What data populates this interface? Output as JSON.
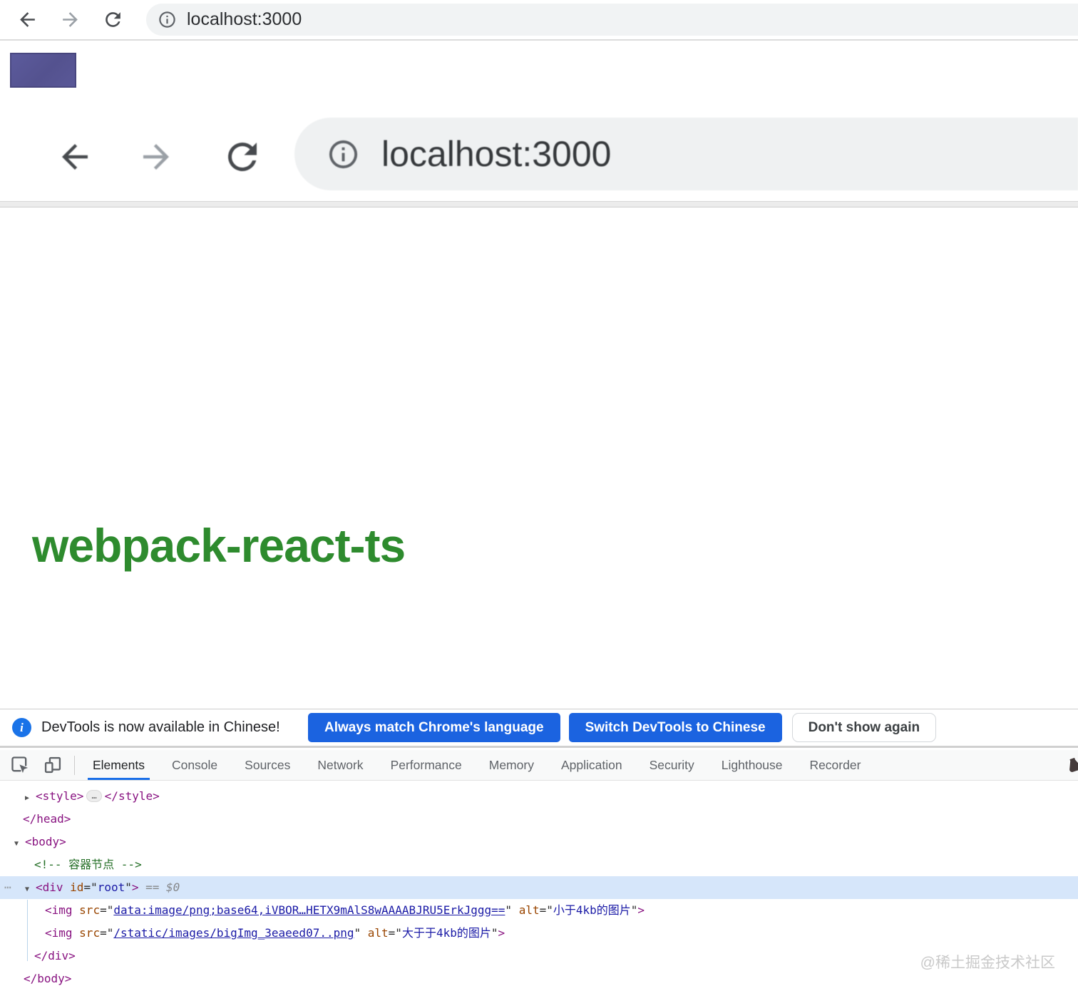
{
  "browser": {
    "url": "localhost:3000"
  },
  "page": {
    "heading": "webpack-react-ts",
    "screenshot_image": {
      "url": "localhost:3000"
    }
  },
  "infobar": {
    "badge_glyph": "i",
    "message": "DevTools is now available in Chinese!",
    "match_button": "Always match Chrome's language",
    "switch_button": "Switch DevTools to Chinese",
    "dismiss_button": "Don't show again"
  },
  "devtools": {
    "tabs": [
      {
        "label": "Elements",
        "active": true
      },
      {
        "label": "Console"
      },
      {
        "label": "Sources"
      },
      {
        "label": "Network"
      },
      {
        "label": "Performance"
      },
      {
        "label": "Memory"
      },
      {
        "label": "Application"
      },
      {
        "label": "Security"
      },
      {
        "label": "Lighthouse"
      },
      {
        "label": "Recorder"
      }
    ],
    "code_lines": [
      {
        "pad": 35,
        "tokens": [
          [
            "arrow",
            "▶"
          ],
          [
            "tag",
            "<style>"
          ],
          [
            "pill",
            "…"
          ],
          [
            "tag",
            "</style>"
          ]
        ]
      },
      {
        "pad": 32,
        "tokens": [
          [
            "tag",
            "</head>"
          ]
        ]
      },
      {
        "pad": 20,
        "tokens": [
          [
            "arrow",
            "▼"
          ],
          [
            "tag",
            "<body>"
          ]
        ]
      },
      {
        "pad": 48,
        "tokens": [
          [
            "comment",
            "<!-- 容器节点 -->"
          ]
        ]
      },
      {
        "pad": 35,
        "selected": true,
        "dots": "⋯",
        "tokens": [
          [
            "arrow",
            "▼"
          ],
          [
            "tag",
            "<div"
          ],
          [
            "plain",
            " "
          ],
          [
            "attr",
            "id"
          ],
          [
            "plain",
            "=\""
          ],
          [
            "val",
            "root"
          ],
          [
            "plain",
            "\""
          ],
          [
            "tag",
            ">"
          ],
          [
            "meta",
            " == "
          ],
          [
            "metai",
            "$0"
          ]
        ]
      },
      {
        "pad": 63,
        "tokens": [
          [
            "tag",
            "<img"
          ],
          [
            "plain",
            " "
          ],
          [
            "attr",
            "src"
          ],
          [
            "plain",
            "=\""
          ],
          [
            "link",
            "data:image/png;base64,iVBOR…HETX9mAlS8wAAAABJRU5ErkJggg=="
          ],
          [
            "plain",
            "\" "
          ],
          [
            "attr",
            "alt"
          ],
          [
            "plain",
            "=\""
          ],
          [
            "val",
            "小于4kb的图片"
          ],
          [
            "plain",
            "\""
          ],
          [
            "tag",
            ">"
          ]
        ]
      },
      {
        "pad": 63,
        "tokens": [
          [
            "tag",
            "<img"
          ],
          [
            "plain",
            " "
          ],
          [
            "attr",
            "src"
          ],
          [
            "plain",
            "=\""
          ],
          [
            "link",
            "/static/images/bigImg_3eaeed07..png"
          ],
          [
            "plain",
            "\" "
          ],
          [
            "attr",
            "alt"
          ],
          [
            "plain",
            "=\""
          ],
          [
            "val",
            "大于于4kb的图片"
          ],
          [
            "plain",
            "\""
          ],
          [
            "tag",
            ">"
          ]
        ]
      },
      {
        "pad": 48,
        "tokens": [
          [
            "tag",
            "</div>"
          ]
        ]
      },
      {
        "pad": 33,
        "tokens": [
          [
            "tag",
            "</body>"
          ]
        ]
      }
    ]
  },
  "watermark": "@稀土掘金技术社区",
  "icons": {
    "back": "arrow-back-icon",
    "forward": "arrow-forward-icon",
    "reload": "reload-icon",
    "site_info": "info-icon",
    "infobar_badge": "info-badge-icon",
    "inspect": "inspect-element-icon",
    "device": "toggle-device-toolbar-icon",
    "recorder_edge": "experiment-flask-icon",
    "expand": "triangle-right-icon",
    "collapse": "triangle-down-icon",
    "more_actions": "ellipsis-icon"
  },
  "colors": {
    "accent_blue": "#1a73e8",
    "heading_green": "#2e8b2e",
    "tag_purple": "#881280",
    "attr_orange": "#994500",
    "value_blue": "#1a1aa6",
    "comment_green": "#236e25",
    "selected_row_bg": "#d6e6fa",
    "omnibox_grey": "#f1f3f4"
  }
}
